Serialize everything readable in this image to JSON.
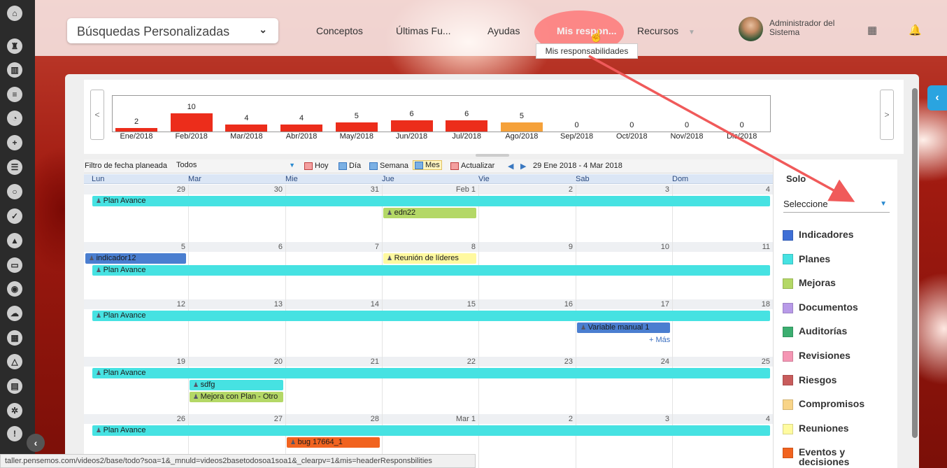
{
  "header": {
    "search": "Búsquedas Personalizadas",
    "nav": [
      "Conceptos",
      "Últimas Fu...",
      "Ayudas",
      "Mis respon...",
      "Recursos"
    ],
    "tooltip": "Mis responsabilidades",
    "user": "Administrador del Sistema"
  },
  "chart_data": {
    "type": "bar",
    "categories": [
      "Ene/2018",
      "Feb/2018",
      "Mar/2018",
      "Abr/2018",
      "May/2018",
      "Jun/2018",
      "Jul/2018",
      "Ago/2018",
      "Sep/2018",
      "Oct/2018",
      "Nov/2018",
      "Dic/2018"
    ],
    "values": [
      2,
      10,
      4,
      4,
      5,
      6,
      6,
      5,
      0,
      0,
      0,
      0
    ],
    "highlight_index": 7,
    "colors": {
      "bar": "#ec2d1b",
      "highlight": "#f5a13a"
    }
  },
  "toolbar": {
    "filter_label": "Filtro de fecha planeada",
    "filter_value": "Todos",
    "hoy": "Hoy",
    "dia": "Día",
    "semana": "Semana",
    "mes": "Mes",
    "actualizar": "Actualizar",
    "range": "29 Ene 2018 - 4 Mar 2018"
  },
  "days": [
    "Lun",
    "Mar",
    "Mie",
    "Jue",
    "Vie",
    "Sab",
    "Dom"
  ],
  "weeks": [
    {
      "dates": [
        "29",
        "30",
        "31",
        "Feb 1",
        "2",
        "3",
        "4"
      ],
      "events": [
        {
          "label": "Plan Avance",
          "type": "plan"
        },
        {
          "label": "edn22",
          "type": "mej"
        }
      ]
    },
    {
      "dates": [
        "5",
        "6",
        "7",
        "8",
        "9",
        "10",
        "11"
      ],
      "events": [
        {
          "label": "indicador12",
          "type": "ind"
        },
        {
          "label": "Reunión de líderes",
          "type": "reu"
        },
        {
          "label": "Plan Avance",
          "type": "plan"
        }
      ]
    },
    {
      "dates": [
        "12",
        "13",
        "14",
        "15",
        "16",
        "17",
        "18"
      ],
      "events": [
        {
          "label": "Plan Avance",
          "type": "plan"
        },
        {
          "label": "Variable manual 1",
          "type": "ind"
        }
      ],
      "more": "+ Más"
    },
    {
      "dates": [
        "19",
        "20",
        "21",
        "22",
        "23",
        "24",
        "25"
      ],
      "events": [
        {
          "label": "Plan Avance",
          "type": "plan"
        },
        {
          "label": "sdfg",
          "type": "plan"
        },
        {
          "label": "Mejora con Plan - Otro",
          "type": "mej"
        }
      ]
    },
    {
      "dates": [
        "26",
        "27",
        "28",
        "Mar 1",
        "2",
        "3",
        "4"
      ],
      "events": [
        {
          "label": "Plan Avance",
          "type": "plan"
        },
        {
          "label": "bug 17664_1",
          "type": "evt"
        }
      ]
    }
  ],
  "legend": {
    "solo": "Solo",
    "select": "Seleccione",
    "items": [
      {
        "label": "Indicadores",
        "color": "#3f6fd6"
      },
      {
        "label": "Planes",
        "color": "#46e2e2"
      },
      {
        "label": "Mejoras",
        "color": "#b4d866"
      },
      {
        "label": "Documentos",
        "color": "#b89ae8"
      },
      {
        "label": "Auditorías",
        "color": "#3cae70"
      },
      {
        "label": "Revisiones",
        "color": "#f596b4"
      },
      {
        "label": "Riesgos",
        "color": "#c85c5c"
      },
      {
        "label": "Compromisos",
        "color": "#f8d488"
      },
      {
        "label": "Reuniones",
        "color": "#fffba0"
      },
      {
        "label": "Eventos y decisiones",
        "color": "#f1631f"
      }
    ]
  },
  "status_url": "taller.pensemos.com/videos2/base/todo?soa=1&_mnuld=videos2basetodosoa1soa1&_clearpv=1&mis=headerResponsbilities"
}
